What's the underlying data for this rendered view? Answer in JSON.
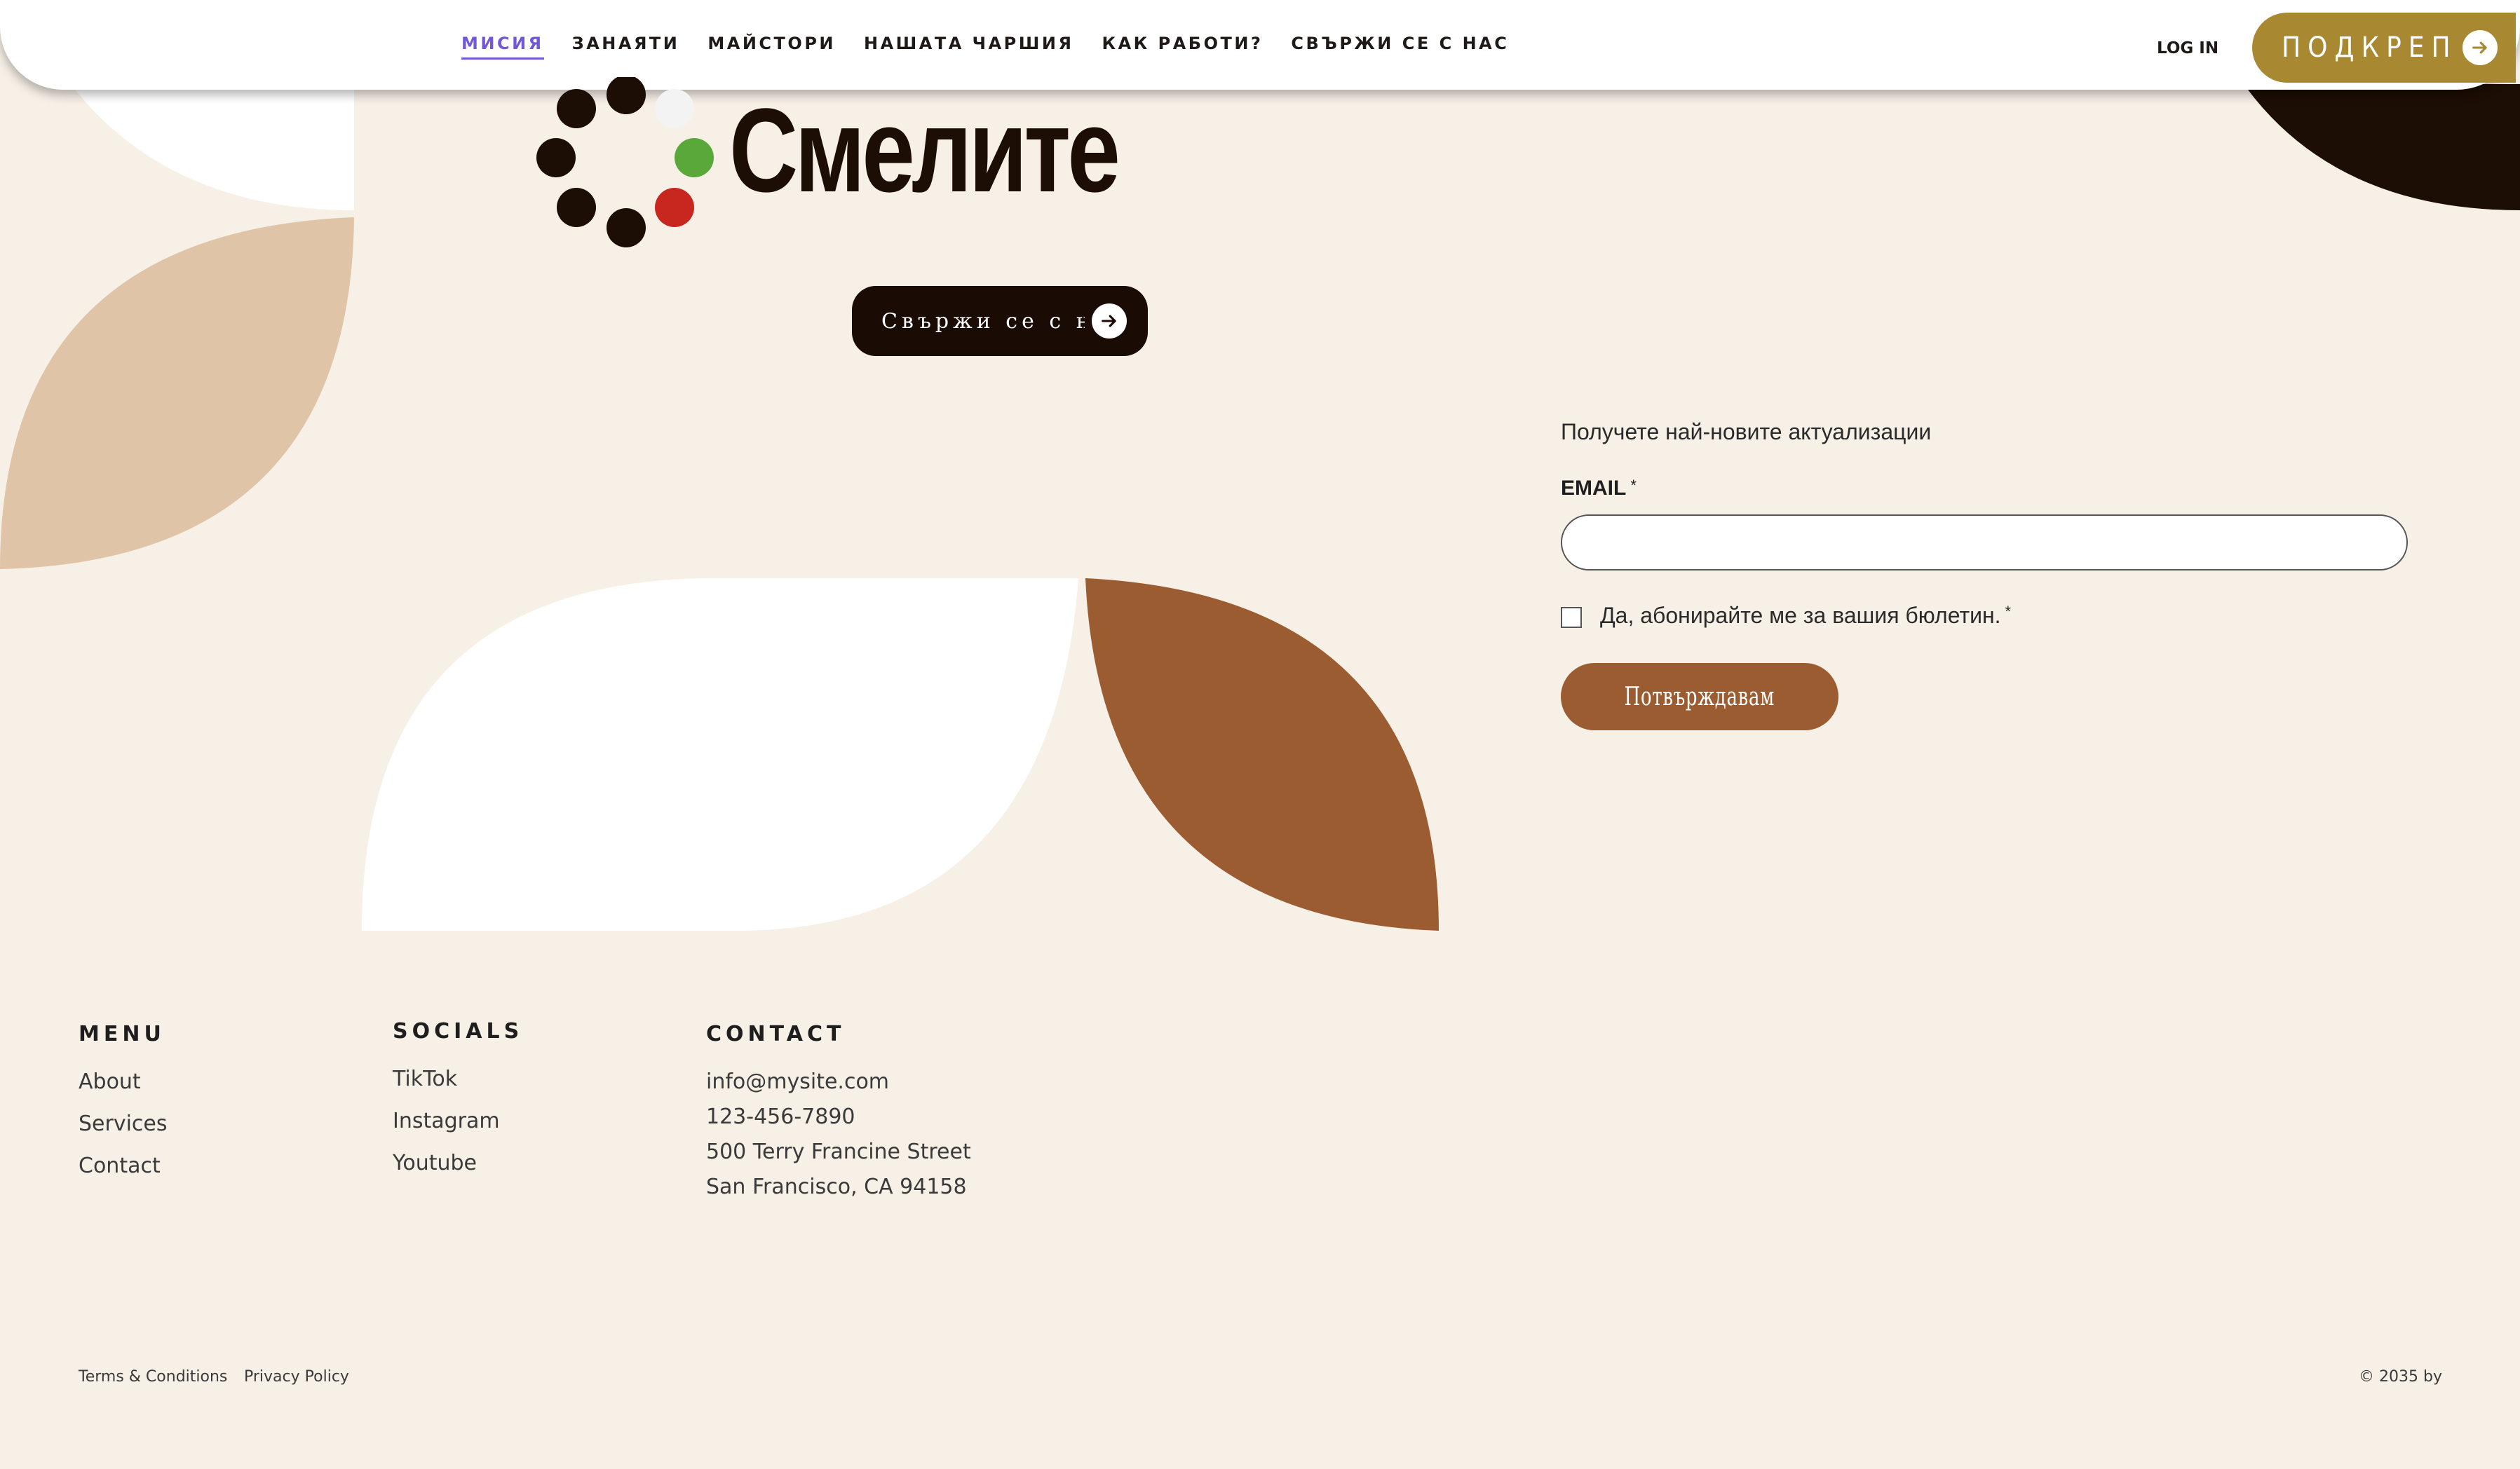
{
  "nav": {
    "items": [
      {
        "label": "МИСИЯ",
        "active": true
      },
      {
        "label": "ЗАНАЯТИ",
        "active": false
      },
      {
        "label": "МАЙСТОРИ",
        "active": false
      },
      {
        "label": "НАШАТА ЧАРШИЯ",
        "active": false
      },
      {
        "label": "КАК РАБОТИ?",
        "active": false
      },
      {
        "label": "СВЪРЖИ СЕ С НАС",
        "active": false
      }
    ],
    "login_label": "LOG IN",
    "support_label": "ПОДКРЕПИ НИ"
  },
  "logo": {
    "text": "Смелите",
    "dot_colors": [
      "#1c0d05",
      "#ffffff",
      "#5aa83a",
      "#c7271f"
    ]
  },
  "hero": {
    "contact_label": "Свържи се с нас"
  },
  "newsletter": {
    "heading": "Получете най-новите актуализации",
    "email_label": "EMAIL",
    "required_mark": "*",
    "email_value": "",
    "checkbox_label": "Да, абонирайте ме за вашия бюлетин.",
    "checkbox_checked": false,
    "submit_label": "Потвърждавам"
  },
  "footer": {
    "menu": {
      "title": "MENU",
      "links": [
        "About",
        "Services",
        "Contact"
      ]
    },
    "socials": {
      "title": "SOCIALS",
      "links": [
        "TikTok",
        "Instagram",
        "Youtube"
      ]
    },
    "contact": {
      "title": "CONTACT",
      "lines": [
        "info@mysite.com",
        "123-456-7890",
        "500 Terry Francine Street",
        "San Francisco, CA 94158"
      ]
    },
    "legal": {
      "terms": "Terms & Conditions",
      "privacy": "Privacy Policy",
      "copyright": "© 2035 by"
    }
  },
  "colors": {
    "background": "#f7f0e7",
    "accent_gold": "#a88932",
    "accent_brown": "#9b5c31",
    "dark": "#1a0b05",
    "beige": "#e0c4a8",
    "active_nav": "#7257d6"
  },
  "icons": {
    "support_arrow": "arrow-right-icon",
    "contact_arrow": "arrow-right-icon"
  }
}
